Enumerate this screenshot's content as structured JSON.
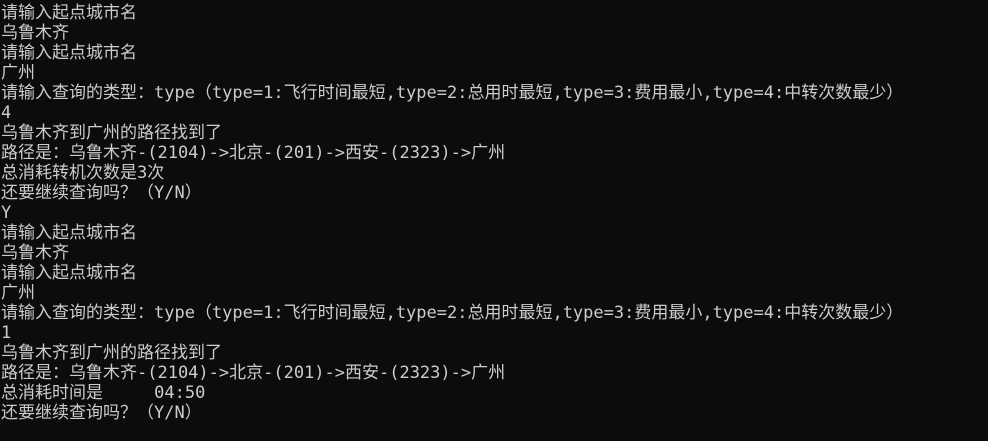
{
  "colors": {
    "background": "#0c0c0c",
    "foreground": "#cccccc"
  },
  "console": {
    "lines": [
      "请输入起点城市名",
      "乌鲁木齐",
      "请输入起点城市名",
      "广州",
      "请输入查询的类型：type（type=1:飞行时间最短,type=2:总用时最短,type=3:费用最小,type=4:中转次数最少）",
      "4",
      "乌鲁木齐到广州的路径找到了",
      "路径是：乌鲁木齐-(2104)->北京-(201)->西安-(2323)->广州",
      "总消耗转机次数是3次",
      "还要继续查询吗？（Y/N）",
      "Y",
      "请输入起点城市名",
      "乌鲁木齐",
      "请输入起点城市名",
      "广州",
      "请输入查询的类型：type（type=1:飞行时间最短,type=2:总用时最短,type=3:费用最小,type=4:中转次数最少）",
      "1",
      "乌鲁木齐到广州的路径找到了",
      "路径是：乌鲁木齐-(2104)->北京-(201)->西安-(2323)->广州",
      "总消耗时间是     04:50",
      "还要继续查询吗？（Y/N）"
    ]
  }
}
